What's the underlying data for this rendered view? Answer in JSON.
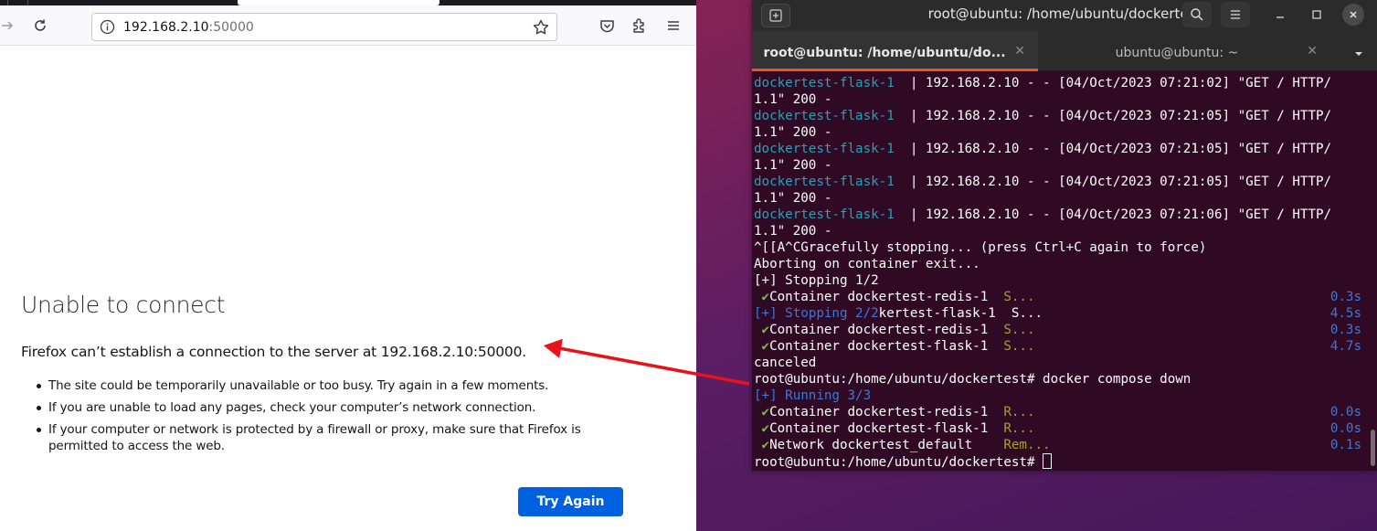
{
  "browser": {
    "url_host": "192.168.2.10",
    "url_port": ":50000",
    "error_title": "Unable to connect",
    "error_lead": "Firefox can’t establish a connection to the server at 192.168.2.10:50000.",
    "error_items": [
      "The site could be temporarily unavailable or too busy. Try again in a few moments.",
      "If you are unable to load any pages, check your computer’s network connection.",
      "If your computer or network is protected by a firewall or proxy, make sure that Firefox is permitted to access the web."
    ],
    "try_again_label": "Try Again"
  },
  "terminal": {
    "window_title": "root@ubuntu: /home/ubuntu/dockertest",
    "tabs": [
      {
        "label": "root@ubuntu: /home/ubuntu/do..."
      },
      {
        "label": "ubuntu@ubuntu: ~"
      }
    ],
    "log_lines": [
      {
        "svc": "dockertest-flask-1  ",
        "rest": "| 192.168.2.10 - - [04/Oct/2023 07:21:02] \"GET / HTTP/",
        "cont": "1.1\" 200 -"
      },
      {
        "svc": "dockertest-flask-1  ",
        "rest": "| 192.168.2.10 - - [04/Oct/2023 07:21:05] \"GET / HTTP/",
        "cont": "1.1\" 200 -"
      },
      {
        "svc": "dockertest-flask-1  ",
        "rest": "| 192.168.2.10 - - [04/Oct/2023 07:21:05] \"GET / HTTP/",
        "cont": "1.1\" 200 -"
      },
      {
        "svc": "dockertest-flask-1  ",
        "rest": "| 192.168.2.10 - - [04/Oct/2023 07:21:05] \"GET / HTTP/",
        "cont": "1.1\" 200 -"
      },
      {
        "svc": "dockertest-flask-1  ",
        "rest": "| 192.168.2.10 - - [04/Oct/2023 07:21:06] \"GET / HTTP/",
        "cont": "1.1\" 200 -"
      }
    ],
    "line_ctrl_c": "^[[A^CGracefully stopping... (press Ctrl+C again to force)",
    "line_abort": "Aborting on container exit...",
    "line_stopping1": "[+] Stopping 1/2",
    "stop1": {
      "check": "✔",
      "name": "Container dockertest-redis-1  ",
      "state": "S...",
      "time": "0.3s"
    },
    "stopping2_head": "[+] Stopping 2/2",
    "stopping2_tail": "kertest-flask-1  ",
    "stopping2_state": "S...",
    "stopping2_time": "4.5s",
    "stop2": {
      "check": "✔",
      "name": "Container dockertest-redis-1  ",
      "state": "S...",
      "time": "0.3s"
    },
    "stop3": {
      "check": "✔",
      "name": "Container dockertest-flask-1  ",
      "state": "S...",
      "time": "4.7s"
    },
    "line_canceled": "canceled",
    "prompt1": "root@ubuntu:/home/ubuntu/dockertest# docker compose down",
    "running_head": "[+] Running 3/3",
    "run1": {
      "check": "✔",
      "name": "Container dockertest-redis-1  ",
      "state": "R...",
      "time": "0.0s"
    },
    "run2": {
      "check": "✔",
      "name": "Container dockertest-flask-1  ",
      "state": "R...",
      "time": "0.0s"
    },
    "run3": {
      "check": "✔",
      "name": "Network dockertest_default    ",
      "state": "Rem...",
      "time": "0.1s"
    },
    "prompt2": "root@ubuntu:/home/ubuntu/dockertest# "
  },
  "colors": {
    "accent_orange": "#e95420",
    "annotation_arrow": "#e8121b",
    "firefox_blue": "#0061e0"
  }
}
